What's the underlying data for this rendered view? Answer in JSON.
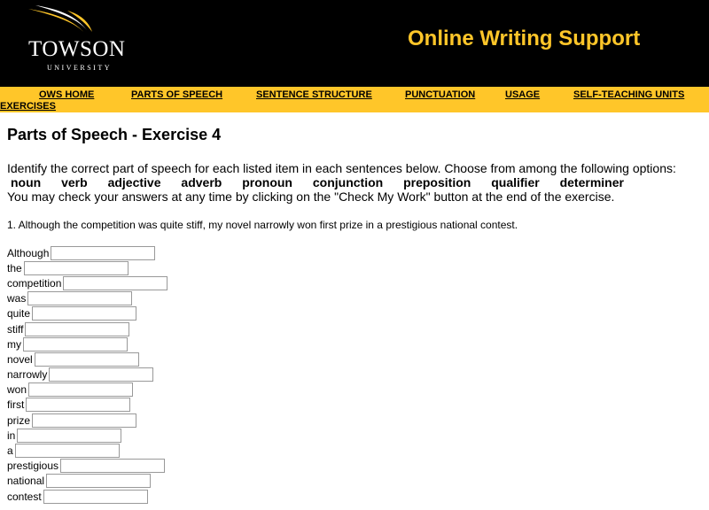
{
  "header": {
    "logo_name": "TOWSON",
    "logo_sub": "UNIVERSITY",
    "title": "Online Writing Support",
    "accent_color": "#ffc629"
  },
  "nav": {
    "items": [
      "OWS HOME",
      "PARTS OF SPEECH",
      "SENTENCE STRUCTURE",
      "PUNCTUATION",
      "USAGE",
      "SELF-TEACHING UNITS",
      "EXERCISES"
    ]
  },
  "page": {
    "heading": "Parts of Speech - Exercise 4",
    "instruction": "Identify the correct part of speech for each listed  item in each sentences below.  Choose from among the following options:",
    "options": [
      "noun",
      "verb",
      "adjective",
      "adverb",
      "pronoun",
      "conjunction",
      "preposition",
      "qualifier",
      "determiner"
    ],
    "check_note": "You may check your answers at any time by clicking on the \"Check My Work\" button at the end of the exercise.",
    "question": "1. Although the competition was quite stiff, my novel narrowly won first prize in a prestigious national contest.",
    "words": [
      "Although",
      "the",
      "competition",
      "was",
      "quite",
      "stiff",
      "my",
      "novel",
      "narrowly",
      "won",
      "first",
      "prize",
      "in",
      "a",
      "prestigious",
      "national",
      "contest"
    ]
  }
}
